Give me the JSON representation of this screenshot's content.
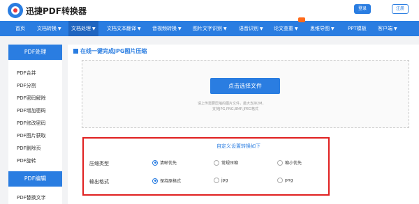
{
  "header": {
    "brand": "迅捷PDF转换器",
    "login_label": "登录",
    "register_label": "注册"
  },
  "nav": {
    "items": [
      {
        "label": "首页",
        "caret": ""
      },
      {
        "label": "文档转换",
        "caret": "▼"
      },
      {
        "label": "文档处理",
        "caret": "▼"
      },
      {
        "label": "文档文本翻译",
        "caret": "▼"
      },
      {
        "label": "音视频转换",
        "caret": "▼"
      },
      {
        "label": "图片文字识别",
        "caret": "▼"
      },
      {
        "label": "语音识别",
        "caret": "▼"
      },
      {
        "label": "论文查重",
        "caret": "▼"
      },
      {
        "label": "思维导图",
        "caret": "▼"
      },
      {
        "label": "PPT模板",
        "caret": ""
      },
      {
        "label": "客户端",
        "caret": "▼"
      }
    ],
    "active_index": 2
  },
  "sidebar": {
    "section1_title": "PDF处理",
    "section1_items": [
      "PDF合并",
      "PDF分割",
      "PDF密码解除",
      "PDF增加密码",
      "PDF修改密码",
      "PDF图片获取",
      "PDF删除页",
      "PDF旋转"
    ],
    "section2_title": "PDF编辑",
    "section2_items": [
      "PDF替换文字"
    ]
  },
  "main": {
    "title": "在线一键完成JPG图片压缩",
    "upload": {
      "button_label": "点击选择文件",
      "hint_line1": "请上传需要压缩的图片文件，最大支持2M，",
      "hint_line2": "支持JPG,PNG,BMP,JPEG格式"
    },
    "settings": {
      "heading": "自定义设置转换如下",
      "compress_label": "压缩类型",
      "compress_options": [
        {
          "label": "清晰优先",
          "selected": true
        },
        {
          "label": "常规压缩",
          "selected": false
        },
        {
          "label": "缩小优先",
          "selected": false
        }
      ],
      "format_label": "输出格式",
      "format_options": [
        {
          "label": "保持原格式",
          "selected": true
        },
        {
          "label": "jpg",
          "selected": false
        },
        {
          "label": "png",
          "selected": false
        }
      ]
    }
  },
  "colors": {
    "primary": "#2a7de1",
    "highlight_border": "#e02020"
  }
}
